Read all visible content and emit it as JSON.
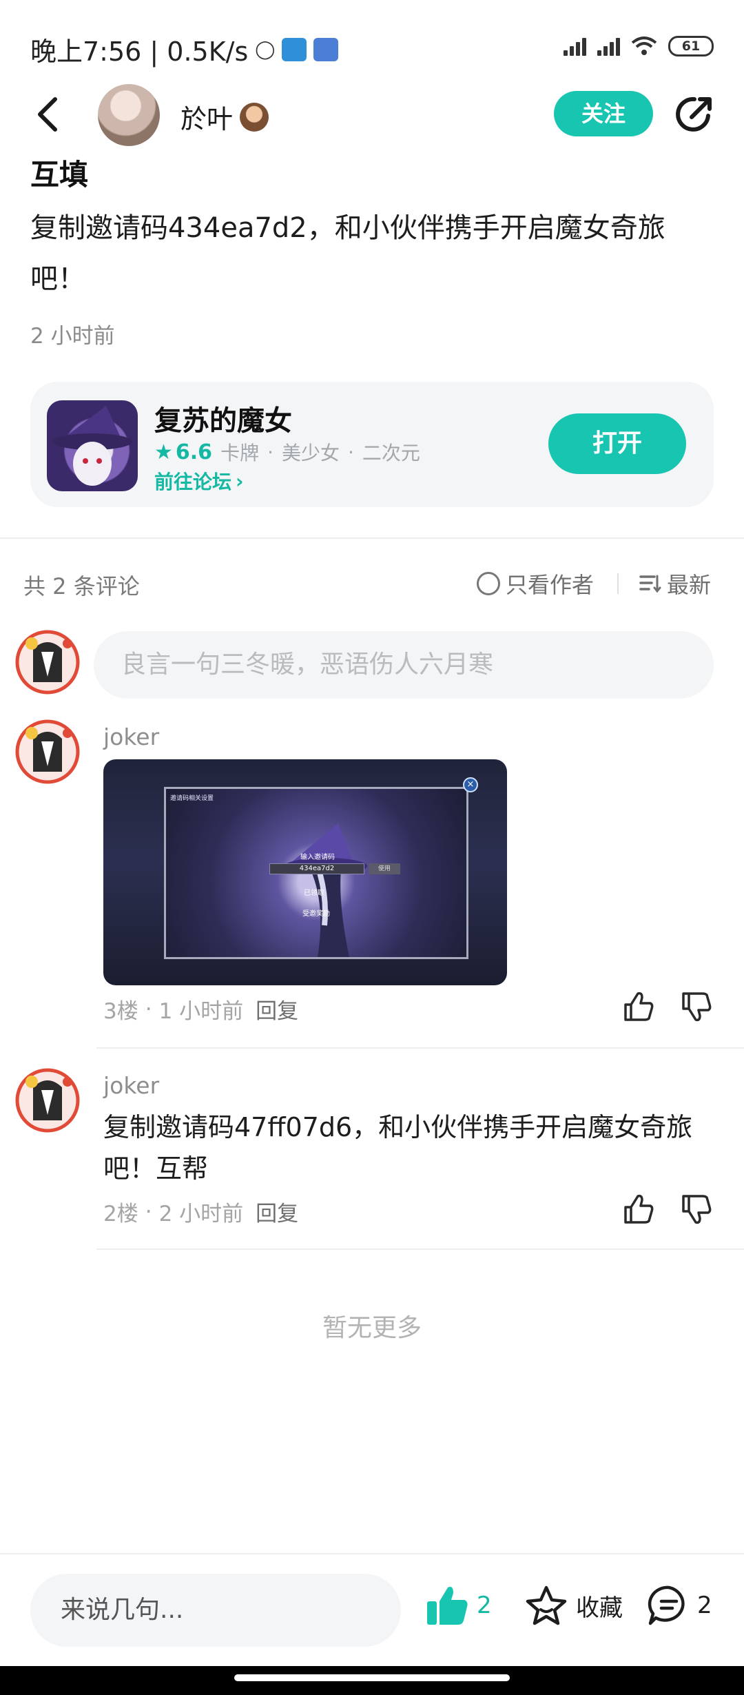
{
  "status_bar": {
    "time_and_speed": "晚上7:56 | 0.5K/s",
    "battery": "61"
  },
  "header": {
    "author_name": "於叶",
    "follow_label": "关注"
  },
  "post": {
    "title": "互填",
    "body": "复制邀请码434ea7d2，和小伙伴携手开启魔女奇旅吧！",
    "time": "2 小时前"
  },
  "game_card": {
    "name": "复苏的魔女",
    "score": "6.6",
    "tags": [
      "卡牌",
      "美少女",
      "二次元"
    ],
    "forum_link": "前往论坛",
    "open_label": "打开"
  },
  "comments_header": {
    "count_text": "共 2 条评论",
    "only_author": "只看作者",
    "sort": "最新"
  },
  "comment_input": {
    "placeholder": "良言一句三冬暖，恶语伤人六月寒"
  },
  "comments": [
    {
      "user": "joker",
      "floor": "3楼",
      "time": "1 小时前",
      "reply": "回复",
      "image": {
        "box_title": "邀请码相关设置",
        "input_label": "输入邀请码",
        "code": "434ea7d2",
        "use": "使用",
        "claimed": "已领取",
        "reward": "受邀奖励"
      }
    },
    {
      "user": "joker",
      "text": "复制邀请码47ff07d6，和小伙伴携手开启魔女奇旅吧！互帮",
      "floor": "2楼",
      "time": "2 小时前",
      "reply": "回复"
    }
  ],
  "no_more": "暂无更多",
  "bottom_bar": {
    "input_placeholder": "来说几句...",
    "like_count": "2",
    "favorite_label": "收藏",
    "comment_count": "2"
  },
  "colors": {
    "accent": "#17c5b0",
    "accent_text": "#14b8a3"
  }
}
